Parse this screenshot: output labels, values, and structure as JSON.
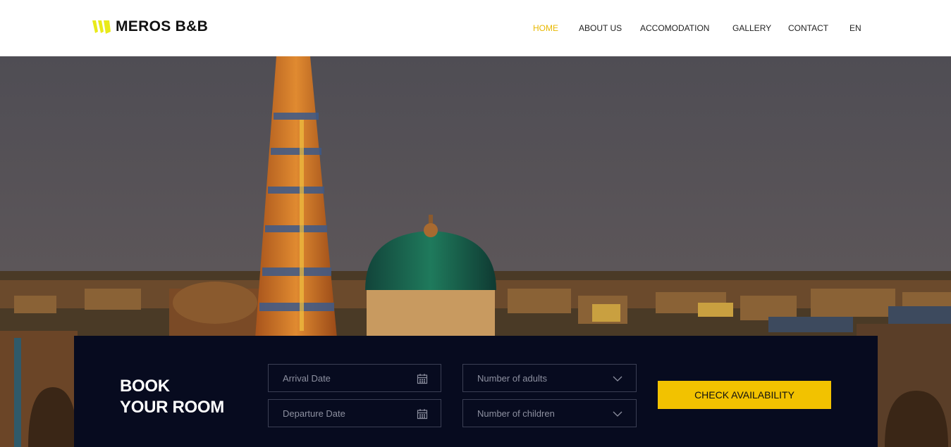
{
  "brand": {
    "name": "MEROS B&B",
    "accent": "#f2c200"
  },
  "nav": {
    "items": [
      {
        "label": "HOME",
        "active": true
      },
      {
        "label": "ABOUT US",
        "active": false
      },
      {
        "label": "ACCOMODATION",
        "active": false
      },
      {
        "label": "GALLERY",
        "active": false
      },
      {
        "label": "CONTACT",
        "active": false
      },
      {
        "label": "EN",
        "active": false
      }
    ]
  },
  "booking": {
    "title_line1": "BOOK",
    "title_line2": "YOUR ROOM",
    "arrival_placeholder": "Arrival Date",
    "departure_placeholder": "Departure Date",
    "adults_placeholder": "Number of adults",
    "children_placeholder": "Number of children",
    "calendar_icon": "calendar-icon",
    "dropdown_icon": "chevron-down-icon",
    "check_label": "CHECK AVAILABILITY"
  }
}
